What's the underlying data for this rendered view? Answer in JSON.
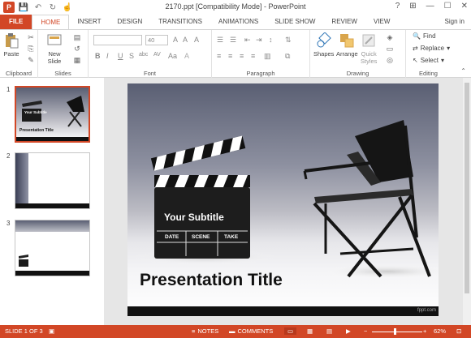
{
  "titlebar": {
    "title": "2170.ppt [Compatibility Mode] - PowerPoint",
    "app_icon": "P",
    "qat": {
      "save": "💾",
      "undo": "↶",
      "redo": "↻",
      "touch": "☝"
    },
    "controls": {
      "help": "?",
      "ribbon_options": "⊞",
      "minimize": "—",
      "maximize": "☐",
      "close": "✕"
    }
  },
  "tabs": [
    "FILE",
    "HOME",
    "INSERT",
    "DESIGN",
    "TRANSITIONS",
    "ANIMATIONS",
    "SLIDE SHOW",
    "REVIEW",
    "VIEW"
  ],
  "signin": "Sign in",
  "ribbon": {
    "clipboard": {
      "label": "Clipboard",
      "paste": "Paste"
    },
    "slides": {
      "label": "Slides",
      "new_slide_1": "New",
      "new_slide_2": "Slide"
    },
    "font": {
      "label": "Font",
      "size": "40"
    },
    "paragraph": {
      "label": "Paragraph"
    },
    "drawing": {
      "label": "Drawing",
      "shapes": "Shapes",
      "arrange": "Arrange",
      "quick_styles_1": "Quick",
      "quick_styles_2": "Styles"
    },
    "editing": {
      "label": "Editing",
      "find": "Find",
      "replace": "Replace",
      "select": "Select"
    }
  },
  "thumbnails": [
    {
      "num": "1",
      "subtitle": "Your Subtitle",
      "title": "Presentation Title"
    },
    {
      "num": "2"
    },
    {
      "num": "3"
    }
  ],
  "slide": {
    "subtitle": "Your Subtitle",
    "cols": [
      "DATE",
      "SCENE",
      "TAKE"
    ],
    "title": "Presentation Title",
    "watermark": "fppt.com"
  },
  "statusbar": {
    "slide_info": "SLIDE 1 OF 3",
    "notes": "NOTES",
    "comments": "COMMENTS",
    "zoom": "62%"
  },
  "colors": {
    "accent": "#d24726"
  }
}
